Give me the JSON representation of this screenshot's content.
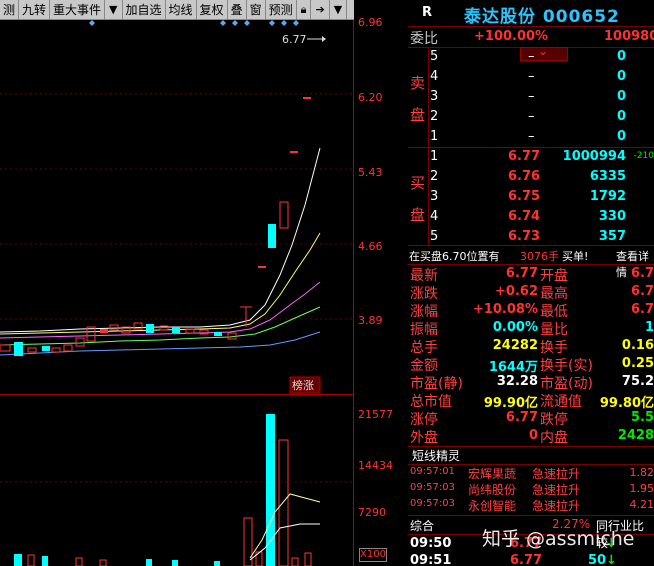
{
  "toolbar": {
    "items": [
      "测",
      "九转",
      "重大事件",
      "加自选",
      "均线",
      "复权",
      "叠",
      "窗",
      "预测"
    ],
    "icons": [
      "dropdown-icon",
      "lock-icon",
      "arrow-icon",
      "dropdown-icon"
    ]
  },
  "kline": {
    "price_labels": [
      "6.96",
      "6.20",
      "5.43",
      "4.66",
      "3.89"
    ],
    "annotation": "6.77",
    "badge": "榜涨"
  },
  "volume": {
    "labels": [
      "21577",
      "14434",
      "7290",
      "X100"
    ]
  },
  "quote": {
    "r": "R",
    "name": "泰达股份 000652",
    "weibi_label": "委比",
    "weibi_value": "+100.00%",
    "weibi_right": "100980",
    "sell_label": [
      "卖",
      "盘"
    ],
    "buy_label": [
      "买",
      "盘"
    ],
    "sell": [
      {
        "n": "5",
        "p": "–",
        "v": "0"
      },
      {
        "n": "4",
        "p": "–",
        "v": "0"
      },
      {
        "n": "3",
        "p": "–",
        "v": "0"
      },
      {
        "n": "2",
        "p": "–",
        "v": "0"
      },
      {
        "n": "1",
        "p": "–",
        "v": "0"
      }
    ],
    "buy": [
      {
        "n": "1",
        "p": "6.77",
        "v": "1000994",
        "x": "-210"
      },
      {
        "n": "2",
        "p": "6.76",
        "v": "6335",
        "x": ""
      },
      {
        "n": "3",
        "p": "6.75",
        "v": "1792",
        "x": ""
      },
      {
        "n": "4",
        "p": "6.74",
        "v": "330",
        "x": ""
      },
      {
        "n": "5",
        "p": "6.73",
        "v": "357",
        "x": ""
      }
    ],
    "note": {
      "a": "在买盘6.70位置有",
      "b": "3076手",
      "c": "买单!",
      "d": "查看详情"
    },
    "stats": [
      {
        "l1": "最新",
        "v1": "6.77",
        "c1": "red",
        "l2": "开盘",
        "v2": "6.7",
        "c2": "red"
      },
      {
        "l1": "涨跌",
        "v1": "+0.62",
        "c1": "red",
        "l2": "最高",
        "v2": "6.7",
        "c2": "red"
      },
      {
        "l1": "涨幅",
        "v1": "+10.08%",
        "c1": "red",
        "l2": "最低",
        "v2": "6.7",
        "c2": "red"
      },
      {
        "l1": "振幅",
        "v1": "0.00%",
        "c1": "cyan",
        "l2": "量比",
        "v2": "1",
        "c2": "cyan"
      },
      {
        "l1": "总手",
        "v1": "24282",
        "c1": "yellow",
        "l2": "换手",
        "v2": "0.16",
        "c2": "yellow"
      },
      {
        "l1": "金额",
        "v1": "1644万",
        "c1": "cyan",
        "l2": "换手(实)",
        "v2": "0.25",
        "c2": "yellow"
      },
      {
        "l1": "市盈(静)",
        "v1": "32.28",
        "c1": "white",
        "l2": "市盈(动)",
        "v2": "75.2",
        "c2": "white"
      },
      {
        "l1": "总市值",
        "v1": "99.90亿",
        "c1": "yellow",
        "l2": "流通值",
        "v2": "99.80亿",
        "c2": "yellow"
      },
      {
        "l1": "涨停",
        "v1": "6.77",
        "c1": "red",
        "l2": "跌停",
        "v2": "5.5",
        "c2": "green"
      },
      {
        "l1": "外盘",
        "v1": "0",
        "c1": "red",
        "l2": "内盘",
        "v2": "2428",
        "c2": "green"
      }
    ],
    "short_title": "短线精灵",
    "short": [
      {
        "t": "09:57:01",
        "n": "宏辉果蔬",
        "a": "急速拉升",
        "v": "1.82"
      },
      {
        "t": "09:57:03",
        "n": "尚纬股份",
        "a": "急速拉升",
        "v": "1.95"
      },
      {
        "t": "09:57:03",
        "n": "永创智能",
        "a": "急速拉升",
        "v": "4.21"
      }
    ],
    "bottom": {
      "zh": "综合",
      "pct": "2.27%",
      "peer": "同行业比较"
    },
    "ticks": [
      {
        "t": "09:50",
        "p": "6.77",
        "v": ""
      },
      {
        "t": "09:51",
        "p": "6.77",
        "v": "50"
      }
    ],
    "watermark": "知乎 @assmiche"
  },
  "colors": {
    "up": "#ff3232",
    "down": "#00ffff",
    "ma1": "#ffffff",
    "ma2": "#ffff66",
    "ma3": "#ff66ff",
    "ma4": "#66ff66",
    "ma5": "#6699ff"
  }
}
